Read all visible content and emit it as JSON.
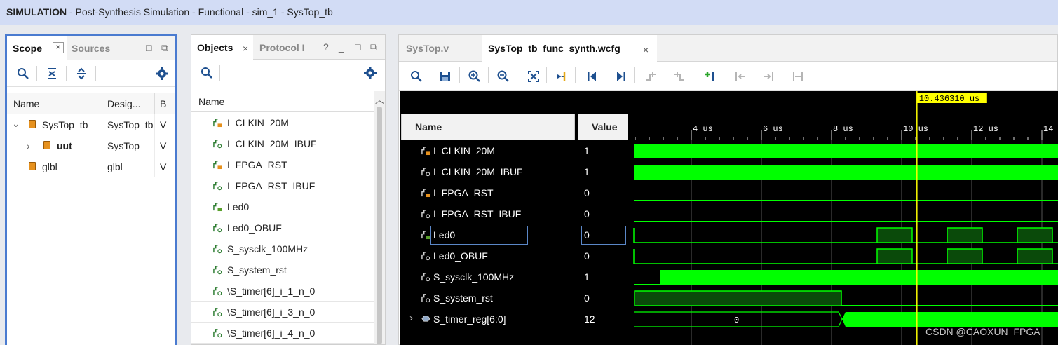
{
  "window": {
    "mode": "SIMULATION",
    "title_rest": " - Post-Synthesis Simulation - Functional - sim_1 - SysTop_tb"
  },
  "scope_panel": {
    "tab_active": "Scope",
    "tab_inactive": "Sources",
    "columns": [
      "Name",
      "Desig...",
      "B"
    ],
    "rows": [
      {
        "name": "SysTop_tb",
        "design": "SysTop_tb",
        "b": "V",
        "expanded": true
      },
      {
        "name": "uut",
        "design": "SysTop",
        "b": "V",
        "expanded": false
      },
      {
        "name": "glbl",
        "design": "glbl",
        "b": "V"
      }
    ]
  },
  "objects_panel": {
    "tab_active": "Objects",
    "tab_inactive": "Protocol I",
    "column": "Name",
    "items": [
      {
        "label": "I_CLKIN_20M",
        "kind": "in"
      },
      {
        "label": "I_CLKIN_20M_IBUF",
        "kind": "net"
      },
      {
        "label": "I_FPGA_RST",
        "kind": "in"
      },
      {
        "label": "I_FPGA_RST_IBUF",
        "kind": "net"
      },
      {
        "label": "Led0",
        "kind": "out"
      },
      {
        "label": "Led0_OBUF",
        "kind": "net"
      },
      {
        "label": "S_sysclk_100MHz",
        "kind": "net"
      },
      {
        "label": "S_system_rst",
        "kind": "net"
      },
      {
        "label": "\\S_timer[6]_i_1_n_0",
        "kind": "net"
      },
      {
        "label": "\\S_timer[6]_i_3_n_0",
        "kind": "net"
      },
      {
        "label": "\\S_timer[6]_i_4_n_0",
        "kind": "net"
      }
    ]
  },
  "wave_panel": {
    "tabs": [
      "SysTop.v",
      "SysTop_tb_func_synth.wcfg"
    ],
    "name_header": "Name",
    "value_header": "Value",
    "cursor_label": "10.436310 us",
    "time_ticks": [
      "4 us",
      "6 us",
      "8 us",
      "10 us",
      "12 us",
      "14"
    ],
    "signals": [
      {
        "name": "I_CLKIN_20M",
        "value": "1",
        "kind": "in"
      },
      {
        "name": "I_CLKIN_20M_IBUF",
        "value": "1",
        "kind": "net"
      },
      {
        "name": "I_FPGA_RST",
        "value": "0",
        "kind": "in"
      },
      {
        "name": "I_FPGA_RST_IBUF",
        "value": "0",
        "kind": "net"
      },
      {
        "name": "Led0",
        "value": "0",
        "kind": "out",
        "selected": true
      },
      {
        "name": "Led0_OBUF",
        "value": "0",
        "kind": "net"
      },
      {
        "name": "S_sysclk_100MHz",
        "value": "1",
        "kind": "net"
      },
      {
        "name": "S_system_rst",
        "value": "0",
        "kind": "net"
      },
      {
        "name": "S_timer_reg[6:0]",
        "value": "12",
        "kind": "bus",
        "bus_value": "0"
      }
    ],
    "waveform_color": "#00ff00",
    "cursor_color": "#ffff00"
  },
  "watermark": "CSDN @CAOXUN_FPGA"
}
